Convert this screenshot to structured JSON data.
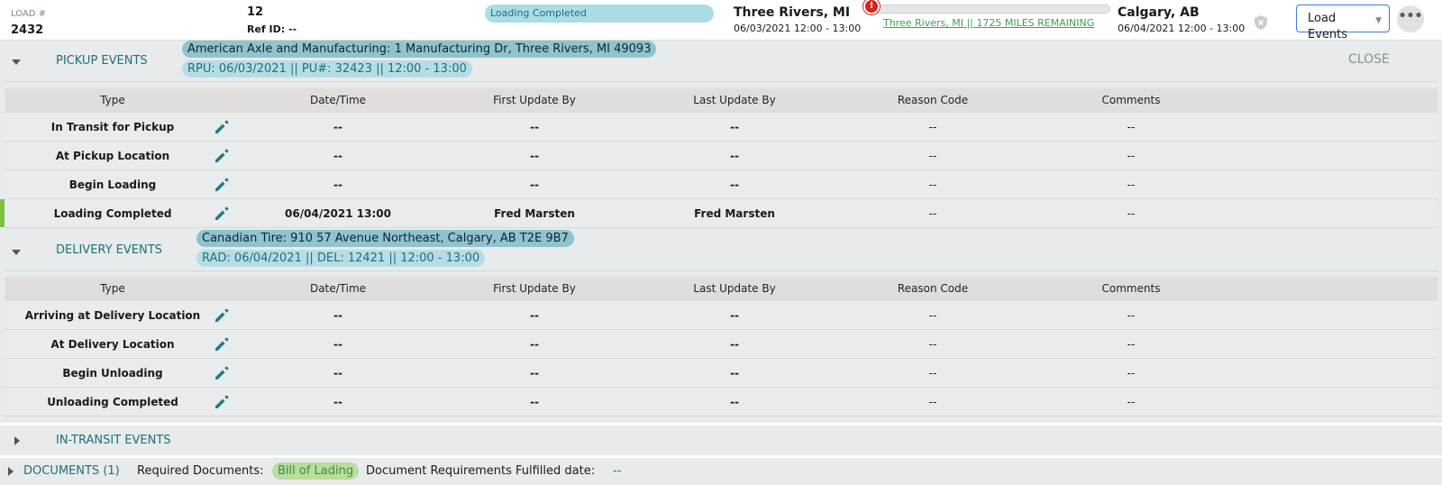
{
  "header": {
    "load_label": "LOAD #",
    "load_number": "2432",
    "ref_number": "12",
    "ref_id": "Ref ID: --",
    "status": "Loading Completed",
    "origin_city": "Three Rivers, MI",
    "origin_window": "06/03/2021 12:00 - 13:00",
    "progress_marker": "!",
    "progress_fraction": 0.0,
    "route_text": "Three Rivers, MI || 1725 MILES REMAINING",
    "dest_city": "Calgary, AB",
    "dest_window": "06/04/2021 12:00 - 13:00",
    "load_events_button": "Load Events",
    "more_button": "•••"
  },
  "colors": {
    "accent": "#1f6f7a",
    "active": "#7cc242",
    "alert": "#d9231f",
    "link_green": "#3aa24a"
  },
  "pickup": {
    "title": "PICKUP EVENTS",
    "address": "American Axle and Manufacturing: 1 Manufacturing Dr, Three Rivers, MI 49093",
    "details": "RPU: 06/03/2021 || PU#: 32423 || 12:00 - 13:00",
    "close": "CLOSE",
    "columns": [
      "Type",
      "Date/Time",
      "First Update By",
      "Last Update By",
      "Reason Code",
      "Comments"
    ],
    "rows": [
      {
        "type": "In Transit for Pickup",
        "date": "--",
        "first": "--",
        "last": "--",
        "reason": "--",
        "comments": "--"
      },
      {
        "type": "At Pickup Location",
        "date": "--",
        "first": "--",
        "last": "--",
        "reason": "--",
        "comments": "--"
      },
      {
        "type": "Begin Loading",
        "date": "--",
        "first": "--",
        "last": "--",
        "reason": "--",
        "comments": "--"
      },
      {
        "type": "Loading Completed",
        "date": "06/04/2021 13:00",
        "first": "Fred Marsten",
        "last": "Fred Marsten",
        "reason": "--",
        "comments": "--"
      }
    ]
  },
  "delivery": {
    "title": "DELIVERY EVENTS",
    "address": "Canadian Tire: 910 57 Avenue Northeast, Calgary, AB T2E 9B7",
    "details": "RAD: 06/04/2021 || DEL: 12421 || 12:00 - 13:00",
    "columns": [
      "Type",
      "Date/Time",
      "First Update By",
      "Last Update By",
      "Reason Code",
      "Comments"
    ],
    "rows": [
      {
        "type": "Arriving at Delivery Location",
        "date": "--",
        "first": "--",
        "last": "--",
        "reason": "--",
        "comments": "--"
      },
      {
        "type": "At Delivery Location",
        "date": "--",
        "first": "--",
        "last": "--",
        "reason": "--",
        "comments": "--"
      },
      {
        "type": "Begin Unloading",
        "date": "--",
        "first": "--",
        "last": "--",
        "reason": "--",
        "comments": "--"
      },
      {
        "type": "Unloading Completed",
        "date": "--",
        "first": "--",
        "last": "--",
        "reason": "--",
        "comments": "--"
      }
    ]
  },
  "in_transit": {
    "title": "IN-TRANSIT EVENTS"
  },
  "documents": {
    "title": "DOCUMENTS (1)",
    "required_label": "Required Documents:",
    "required_doc": "Bill of Lading",
    "fulfilled_label": "Document Requirements Fulfilled date:",
    "fulfilled_value": "--"
  }
}
